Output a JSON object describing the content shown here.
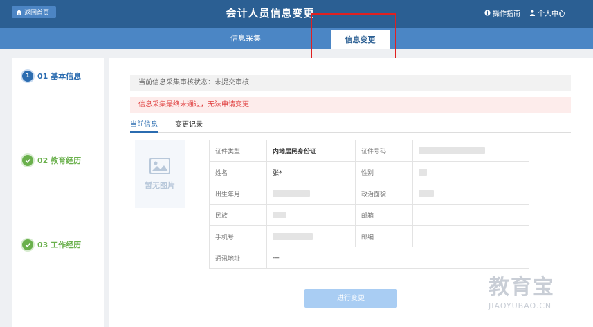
{
  "header": {
    "home_label": "返回首页",
    "title": "会计人员信息变更",
    "help_label": "操作指南",
    "user_label": "个人中心"
  },
  "tabs": [
    {
      "label": "信息采集",
      "active": false
    },
    {
      "label": "信息变更",
      "active": true
    }
  ],
  "steps": [
    {
      "label": "01 基本信息",
      "marker": "1",
      "state": "current"
    },
    {
      "label": "02 教育经历",
      "marker": "check",
      "state": "done"
    },
    {
      "label": "03 工作经历",
      "marker": "check",
      "state": "done"
    }
  ],
  "status": {
    "review_text": "当前信息采集审核状态：未提交审核",
    "alert_text": "信息采集最终未通过，无法申请变更"
  },
  "subtabs": [
    {
      "label": "当前信息",
      "active": true
    },
    {
      "label": "变更记录",
      "active": false
    }
  ],
  "photo": {
    "placeholder": "暂无图片"
  },
  "info_table": {
    "rows": [
      {
        "l1": "证件类型",
        "v1": "内地居民身份证",
        "l2": "证件号码",
        "v2": ""
      },
      {
        "l1": "姓名",
        "v1": "张*",
        "l2": "性别",
        "v2": ""
      },
      {
        "l1": "出生年月",
        "v1": "",
        "l2": "政治面貌",
        "v2": ""
      },
      {
        "l1": "民族",
        "v1": "",
        "l2": "邮箱",
        "v2": ""
      },
      {
        "l1": "手机号",
        "v1": "",
        "l2": "邮编",
        "v2": ""
      }
    ],
    "address_label": "通讯地址",
    "address_value": "---"
  },
  "submit_label": "进行变更",
  "watermark": {
    "big": "教育宝",
    "small": "JIAOYUBAO.CN"
  },
  "colors": {
    "header": "#2b5f93",
    "tabbar": "#4b86c5",
    "step_current": "#2b6cb0",
    "step_done": "#6ab04c",
    "alert": "#e04040"
  }
}
